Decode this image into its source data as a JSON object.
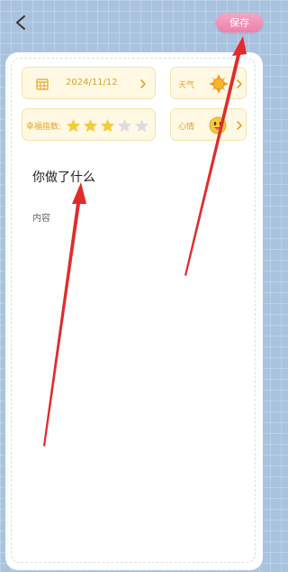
{
  "header": {
    "save_label": "保存"
  },
  "toolbar": {
    "date": "2024/11/12",
    "weather_label": "天气",
    "rating_label": "幸福指数:",
    "rating_value": 3,
    "rating_max": 5,
    "mood_label": "心情"
  },
  "editor": {
    "title_placeholder": "你做了什么",
    "content_placeholder": "内容"
  },
  "colors": {
    "accent_pink": "#ee7fa9",
    "star_filled": "#f2cd3b",
    "star_empty": "#dcdcdc",
    "annotation_arrow": "#e22b2b"
  }
}
